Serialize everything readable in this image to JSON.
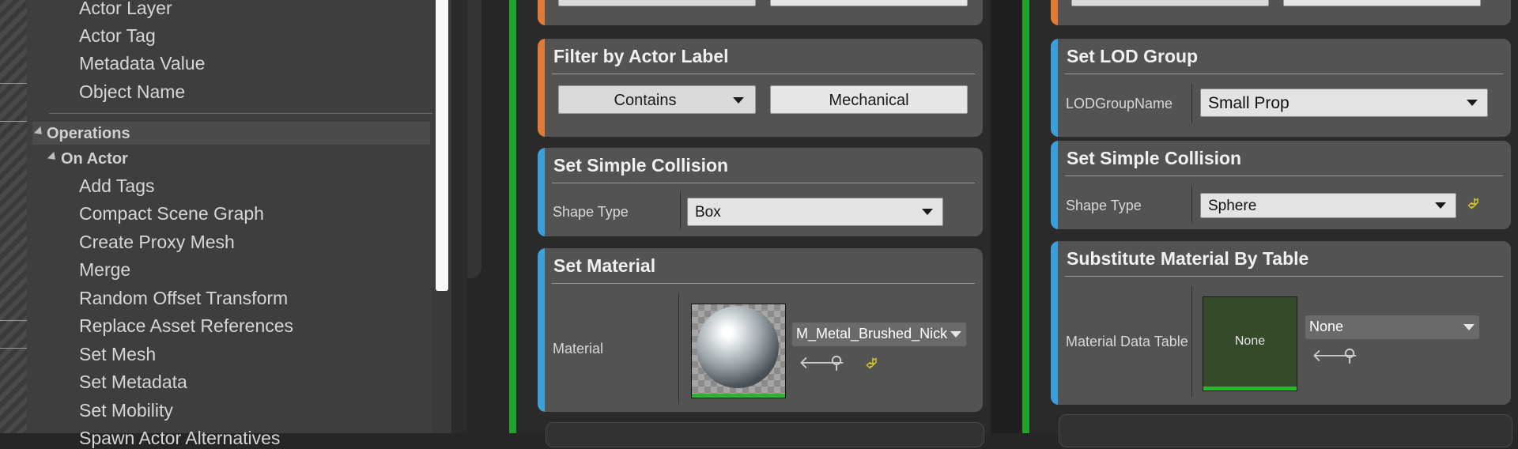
{
  "tree": {
    "top_items": [
      "Actor Layer",
      "Actor Tag",
      "Metadata Value",
      "Object Name"
    ],
    "category": "Operations",
    "subcategory": "On Actor",
    "items": [
      "Add Tags",
      "Compact Scene Graph",
      "Create Proxy Mesh",
      "Merge",
      "Random Offset Transform",
      "Replace Asset References",
      "Set Mesh",
      "Set Metadata",
      "Set Mobility",
      "Spawn Actor Alternatives"
    ]
  },
  "left_column": {
    "filter_card": {
      "title": "Filter by Actor Label",
      "mode": "Contains",
      "value": "Mechanical"
    },
    "collision_card": {
      "title": "Set Simple Collision",
      "label": "Shape Type",
      "value": "Box"
    },
    "material_card": {
      "title": "Set Material",
      "label": "Material",
      "asset": "M_Metal_Brushed_Nickel"
    }
  },
  "right_column": {
    "lod_card": {
      "title": "Set LOD Group",
      "label": "LODGroupName",
      "value": "Small Prop"
    },
    "collision_card": {
      "title": "Set Simple Collision",
      "label": "Shape Type",
      "value": "Sphere"
    },
    "table_card": {
      "title": "Substitute Material By Table",
      "label": "Material Data Table",
      "thumb_text": "None",
      "asset": "None"
    }
  },
  "icons": {
    "browse": "arrow-left-icon",
    "find": "magnifier-icon",
    "reset": "reset-arrow-icon"
  },
  "colors": {
    "accent_orange": "#e07a35",
    "accent_blue": "#3b9fd9",
    "green_rail": "#1fa32b",
    "card_bg": "#535353"
  }
}
